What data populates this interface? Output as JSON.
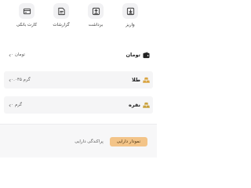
{
  "actions": [
    {
      "label": "واریز",
      "icon": "deposit-icon"
    },
    {
      "label": "برداشت",
      "icon": "withdraw-icon"
    },
    {
      "label": "گزارشات",
      "icon": "reports-icon"
    },
    {
      "label": "کارت بانکی",
      "icon": "bank-card-icon"
    }
  ],
  "assets": {
    "toman": {
      "name": "تومان",
      "value": "۰ تومان",
      "icon": "wallet-icon"
    },
    "gold": {
      "name": "طلا",
      "value": "۰.۰۴۵ گرم",
      "icon": "gold-bars-icon",
      "color": "#d9a441"
    },
    "silver": {
      "name": "نقره",
      "value": "۰ گرم",
      "icon": "silver-bars-icon",
      "color": "#c9a13d"
    }
  },
  "chart_tabs": {
    "active": "نمودار دارایی",
    "inactive": "پراکندگی دارایی",
    "active_color": "#f3c488"
  }
}
